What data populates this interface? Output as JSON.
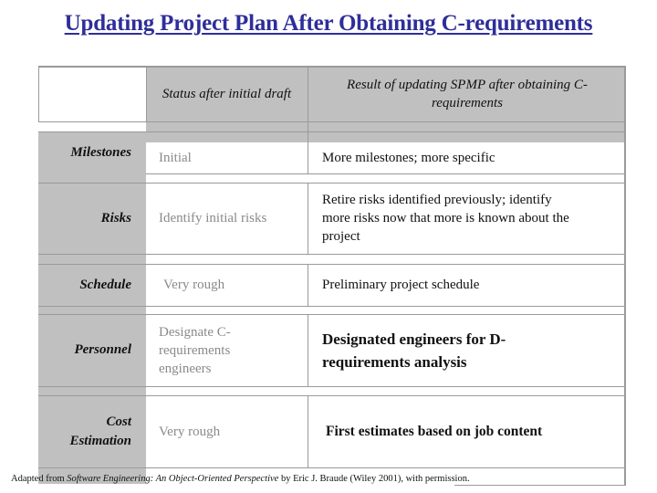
{
  "title": "Updating Project Plan After Obtaining C-requirements",
  "table": {
    "headers": {
      "col1": "",
      "col2": "Status after initial draft",
      "col3": "Result of updating SPMP after obtaining C-requirements"
    },
    "rows": [
      {
        "label": "Milestones",
        "status": "Initial",
        "result": "More milestones; more specific"
      },
      {
        "label": "Risks",
        "status": "Identify initial risks",
        "result": "Retire risks identified previously; identify more risks now that more is known about the project"
      },
      {
        "label": "Schedule",
        "status": "Very rough",
        "result": "Preliminary project schedule"
      },
      {
        "label": "Personnel",
        "status": "Designate C-requirements engineers",
        "result": "Designated engineers for D-requirements analysis"
      },
      {
        "label": "Cost Estimation",
        "status": "Very rough",
        "result": "First estimates based on job content"
      }
    ]
  },
  "footer": {
    "prefix": "Adapted from ",
    "book_title": "Software Engineering: An Object-Oriented Perspective",
    "suffix": " by Eric J. Braude (Wiley 2001), with permission."
  },
  "colors": {
    "title": "#2e2e9a",
    "header_fill": "#c0c0c0",
    "label_fill": "#c0c0c0",
    "status_text": "#8a8a8a",
    "grid_line": "#9a9a9a"
  }
}
